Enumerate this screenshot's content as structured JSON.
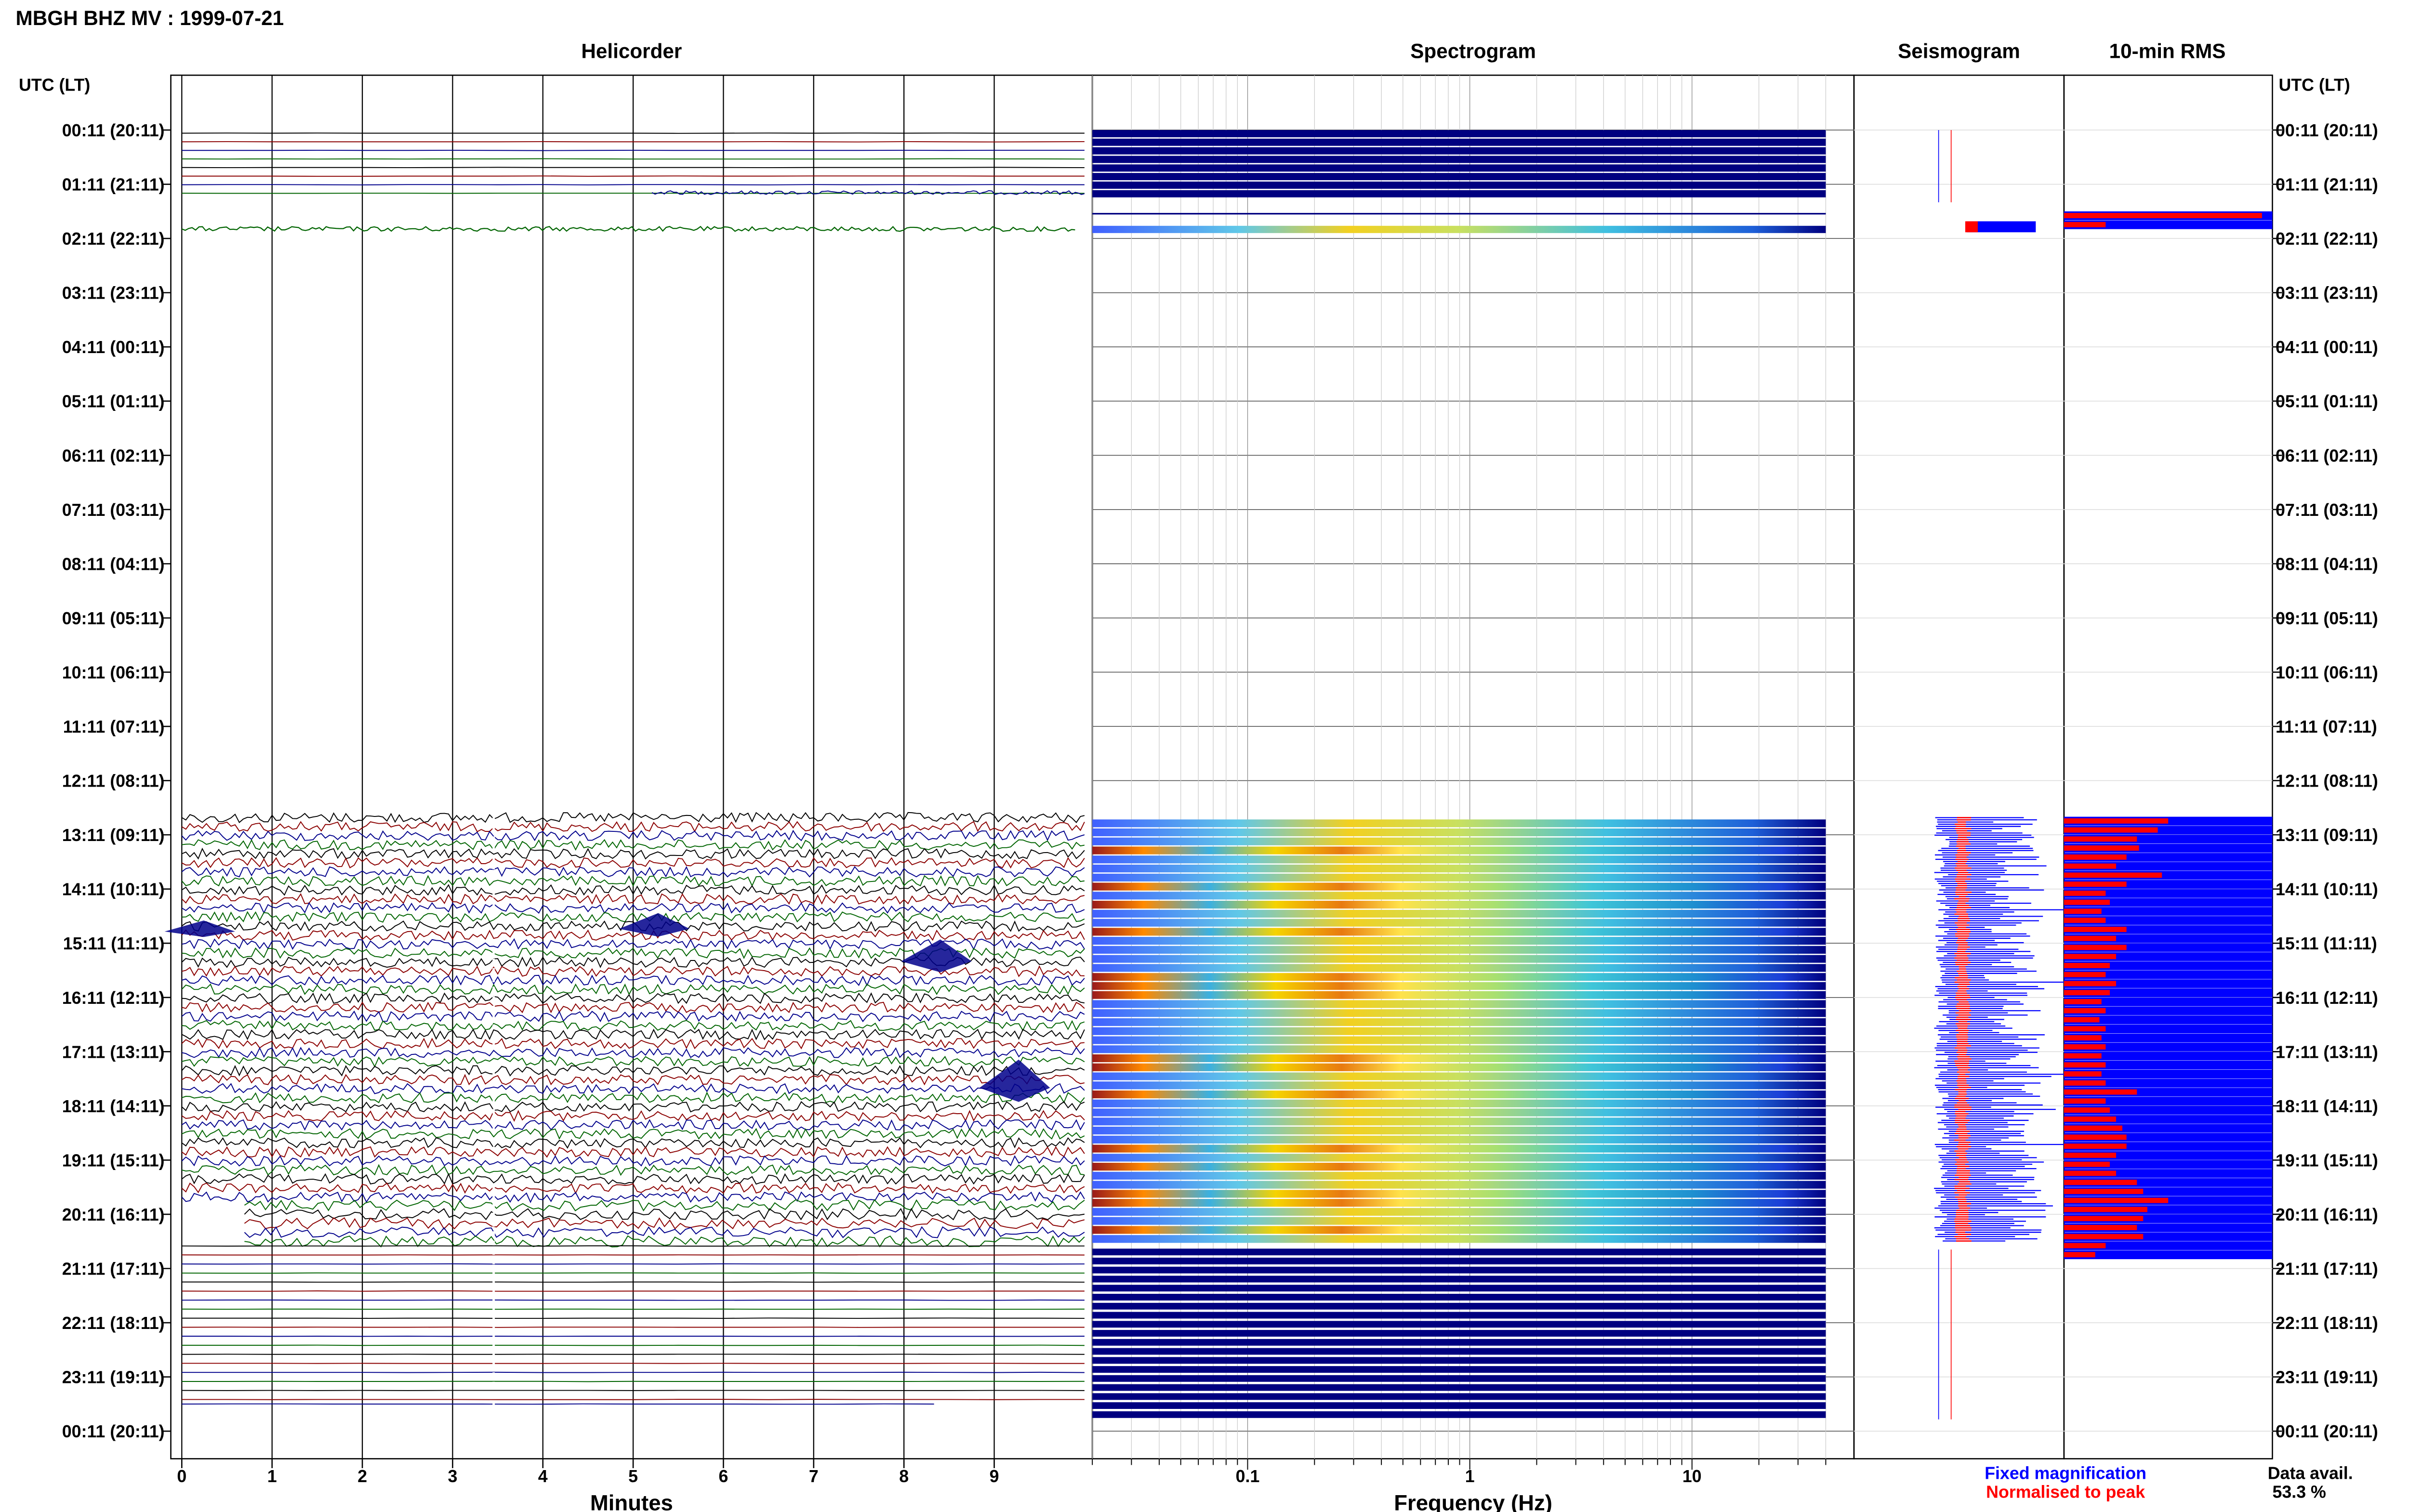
{
  "header": {
    "title": "MBGH BHZ MV : 1999-07-21"
  },
  "panels": {
    "helicorder": "Helicorder",
    "spectrogram": "Spectrogram",
    "seismogram": "Seismogram",
    "rms": "10-min RMS"
  },
  "axis": {
    "left_title": "UTC (LT)",
    "right_title": "UTC (LT)",
    "minutes_label": "Minutes",
    "frequency_label": "Frequency (Hz)"
  },
  "legend": {
    "fixed": "Fixed magnification",
    "normalised": "Normalised to peak",
    "fixed_color": "#0000ff",
    "normalised_color": "#ff0000"
  },
  "availability": {
    "label": "Data avail.",
    "value": "53.3 %"
  },
  "colors": {
    "trace_black": "#000000",
    "trace_red": "#8b0000",
    "trace_blue": "#00008b",
    "trace_green": "#006400",
    "spec_low": "#000080"
  },
  "chart_data": {
    "type": "table",
    "time_labels": [
      "00:11 (20:11)",
      "01:11 (21:11)",
      "02:11 (22:11)",
      "03:11 (23:11)",
      "04:11 (00:11)",
      "05:11 (01:11)",
      "06:11 (02:11)",
      "07:11 (03:11)",
      "08:11 (04:11)",
      "09:11 (05:11)",
      "10:11 (06:11)",
      "11:11 (07:11)",
      "12:11 (08:11)",
      "13:11 (09:11)",
      "14:11 (10:11)",
      "15:11 (11:11)",
      "16:11 (12:11)",
      "17:11 (13:11)",
      "18:11 (14:11)",
      "19:11 (15:11)",
      "20:11 (16:11)",
      "21:11 (17:11)",
      "22:11 (18:11)",
      "23:11 (19:11)",
      "00:11 (20:11)"
    ],
    "minute_ticks": [
      "0",
      "1",
      "2",
      "3",
      "4",
      "5",
      "6",
      "7",
      "8",
      "9"
    ],
    "minutes_range": [
      0,
      10
    ],
    "frequency_ticks": [
      {
        "value": 0.1,
        "label": "0.1"
      },
      {
        "value": 1,
        "label": "1"
      },
      {
        "value": 10,
        "label": "10"
      }
    ],
    "frequency_range": [
      0.02,
      40
    ],
    "frequency_scale": "log",
    "rms_10min_units_relative": [
      {
        "t": "01:41",
        "fixed": 1.0,
        "norm": 0.95
      },
      {
        "t": "01:51",
        "fixed": 1.0,
        "norm": 0.2
      },
      {
        "t": "12:51",
        "fixed": 1.0,
        "norm": 0.5
      },
      {
        "t": "13:01",
        "fixed": 1.0,
        "norm": 0.45
      },
      {
        "t": "13:11",
        "fixed": 1.0,
        "norm": 0.35
      },
      {
        "t": "13:21",
        "fixed": 1.0,
        "norm": 0.36
      },
      {
        "t": "13:31",
        "fixed": 1.0,
        "norm": 0.3
      },
      {
        "t": "13:41",
        "fixed": 1.0,
        "norm": 0.25
      },
      {
        "t": "13:51",
        "fixed": 1.0,
        "norm": 0.47
      },
      {
        "t": "14:01",
        "fixed": 1.0,
        "norm": 0.3
      },
      {
        "t": "14:11",
        "fixed": 1.0,
        "norm": 0.2
      },
      {
        "t": "14:21",
        "fixed": 1.0,
        "norm": 0.22
      },
      {
        "t": "14:31",
        "fixed": 1.0,
        "norm": 0.18
      },
      {
        "t": "14:41",
        "fixed": 1.0,
        "norm": 0.2
      },
      {
        "t": "14:51",
        "fixed": 1.0,
        "norm": 0.3
      },
      {
        "t": "15:01",
        "fixed": 1.0,
        "norm": 0.25
      },
      {
        "t": "15:11",
        "fixed": 1.0,
        "norm": 0.3
      },
      {
        "t": "15:21",
        "fixed": 1.0,
        "norm": 0.25
      },
      {
        "t": "15:31",
        "fixed": 1.0,
        "norm": 0.22
      },
      {
        "t": "15:41",
        "fixed": 1.0,
        "norm": 0.2
      },
      {
        "t": "15:51",
        "fixed": 1.0,
        "norm": 0.25
      },
      {
        "t": "16:01",
        "fixed": 1.0,
        "norm": 0.22
      },
      {
        "t": "16:11",
        "fixed": 1.0,
        "norm": 0.18
      },
      {
        "t": "16:21",
        "fixed": 1.0,
        "norm": 0.2
      },
      {
        "t": "16:31",
        "fixed": 1.0,
        "norm": 0.17
      },
      {
        "t": "16:41",
        "fixed": 1.0,
        "norm": 0.2
      },
      {
        "t": "16:51",
        "fixed": 1.0,
        "norm": 0.18
      },
      {
        "t": "17:01",
        "fixed": 1.0,
        "norm": 0.2
      },
      {
        "t": "17:11",
        "fixed": 1.0,
        "norm": 0.18
      },
      {
        "t": "17:21",
        "fixed": 1.0,
        "norm": 0.2
      },
      {
        "t": "17:31",
        "fixed": 1.0,
        "norm": 0.18
      },
      {
        "t": "17:41",
        "fixed": 1.0,
        "norm": 0.2
      },
      {
        "t": "17:51",
        "fixed": 1.0,
        "norm": 0.35
      },
      {
        "t": "18:01",
        "fixed": 1.0,
        "norm": 0.2
      },
      {
        "t": "18:11",
        "fixed": 1.0,
        "norm": 0.22
      },
      {
        "t": "18:21",
        "fixed": 1.0,
        "norm": 0.25
      },
      {
        "t": "18:31",
        "fixed": 1.0,
        "norm": 0.28
      },
      {
        "t": "18:41",
        "fixed": 1.0,
        "norm": 0.3
      },
      {
        "t": "18:51",
        "fixed": 1.0,
        "norm": 0.3
      },
      {
        "t": "19:01",
        "fixed": 1.0,
        "norm": 0.25
      },
      {
        "t": "19:11",
        "fixed": 1.0,
        "norm": 0.22
      },
      {
        "t": "19:21",
        "fixed": 1.0,
        "norm": 0.25
      },
      {
        "t": "19:31",
        "fixed": 1.0,
        "norm": 0.35
      },
      {
        "t": "19:41",
        "fixed": 1.0,
        "norm": 0.38
      },
      {
        "t": "19:51",
        "fixed": 1.0,
        "norm": 0.5
      },
      {
        "t": "20:01",
        "fixed": 1.0,
        "norm": 0.4
      },
      {
        "t": "20:11",
        "fixed": 1.0,
        "norm": 0.38
      },
      {
        "t": "20:21",
        "fixed": 1.0,
        "norm": 0.35
      },
      {
        "t": "20:31",
        "fixed": 1.0,
        "norm": 0.38
      },
      {
        "t": "20:41",
        "fixed": 1.0,
        "norm": 0.2
      },
      {
        "t": "20:51",
        "fixed": 1.0,
        "norm": 0.15
      }
    ]
  }
}
